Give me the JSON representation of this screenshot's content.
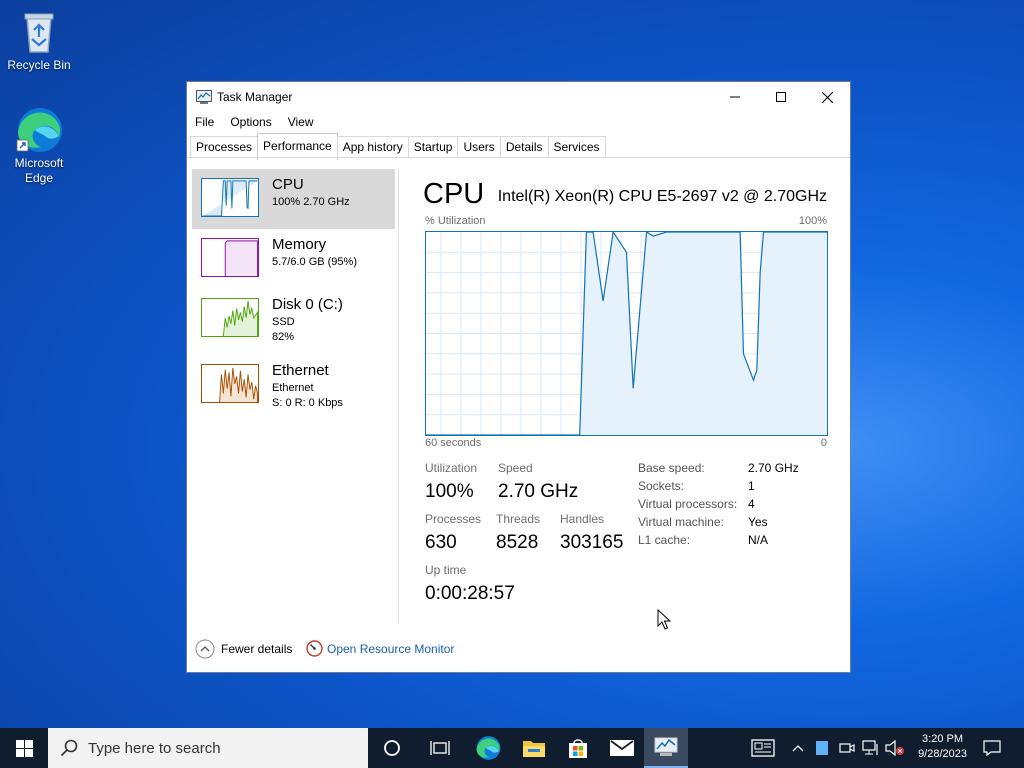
{
  "desktop": {
    "icons": [
      {
        "label": "Recycle Bin"
      },
      {
        "label": "Microsoft Edge"
      }
    ]
  },
  "window": {
    "title": "Task Manager",
    "menu": [
      "File",
      "Options",
      "View"
    ],
    "tabs": [
      "Processes",
      "Performance",
      "App history",
      "Startup",
      "Users",
      "Details",
      "Services"
    ],
    "active_tab": "Performance"
  },
  "sidebar": {
    "items": [
      {
        "name": "CPU",
        "sub1": "100%  2.70 GHz",
        "sub2": "",
        "color": "#1172b8"
      },
      {
        "name": "Memory",
        "sub1": "5.7/6.0 GB (95%)",
        "sub2": "",
        "color": "#8b12ae"
      },
      {
        "name": "Disk 0 (C:)",
        "sub1": "SSD",
        "sub2": "82%",
        "color": "#4da60c"
      },
      {
        "name": "Ethernet",
        "sub1": "Ethernet",
        "sub2": "S: 0  R: 0 Kbps",
        "color": "#a74f01"
      }
    ]
  },
  "main": {
    "title": "CPU",
    "model": "Intel(R) Xeon(R) CPU E5-2697 v2 @ 2.70GHz",
    "util_label": "% Utilization",
    "util_max": "100%",
    "axis_left": "60 seconds",
    "axis_right": "0",
    "stats": {
      "utilization_label": "Utilization",
      "utilization": "100%",
      "speed_label": "Speed",
      "speed": "2.70 GHz",
      "processes_label": "Processes",
      "processes": "630",
      "threads_label": "Threads",
      "threads": "8528",
      "handles_label": "Handles",
      "handles": "303165",
      "uptime_label": "Up time",
      "uptime": "0:00:28:57"
    },
    "specs": [
      {
        "label": "Base speed:",
        "value": "2.70 GHz"
      },
      {
        "label": "Sockets:",
        "value": "1"
      },
      {
        "label": "Virtual processors:",
        "value": "4"
      },
      {
        "label": "Virtual machine:",
        "value": "Yes"
      },
      {
        "label": "L1 cache:",
        "value": "N/A"
      }
    ]
  },
  "footer": {
    "fewer_details": "Fewer details",
    "resource_monitor": "Open Resource Monitor"
  },
  "taskbar": {
    "search_placeholder": "Type here to search",
    "time": "3:20 PM",
    "date": "9/28/2023"
  },
  "chart_data": {
    "type": "area",
    "x_range": [
      60,
      0
    ],
    "ylim": [
      0,
      100
    ],
    "x": [
      60,
      37,
      36,
      35,
      33.5,
      32,
      30,
      29,
      27,
      26,
      24,
      20,
      15,
      13,
      12.5,
      11,
      10.5,
      10,
      9.5,
      7,
      0
    ],
    "values": [
      0,
      0,
      100,
      100,
      66,
      100,
      90,
      23,
      100,
      98,
      100,
      100,
      100,
      100,
      40,
      27,
      32,
      80,
      100,
      100,
      100
    ],
    "grid": true,
    "color": "#1172b8"
  }
}
